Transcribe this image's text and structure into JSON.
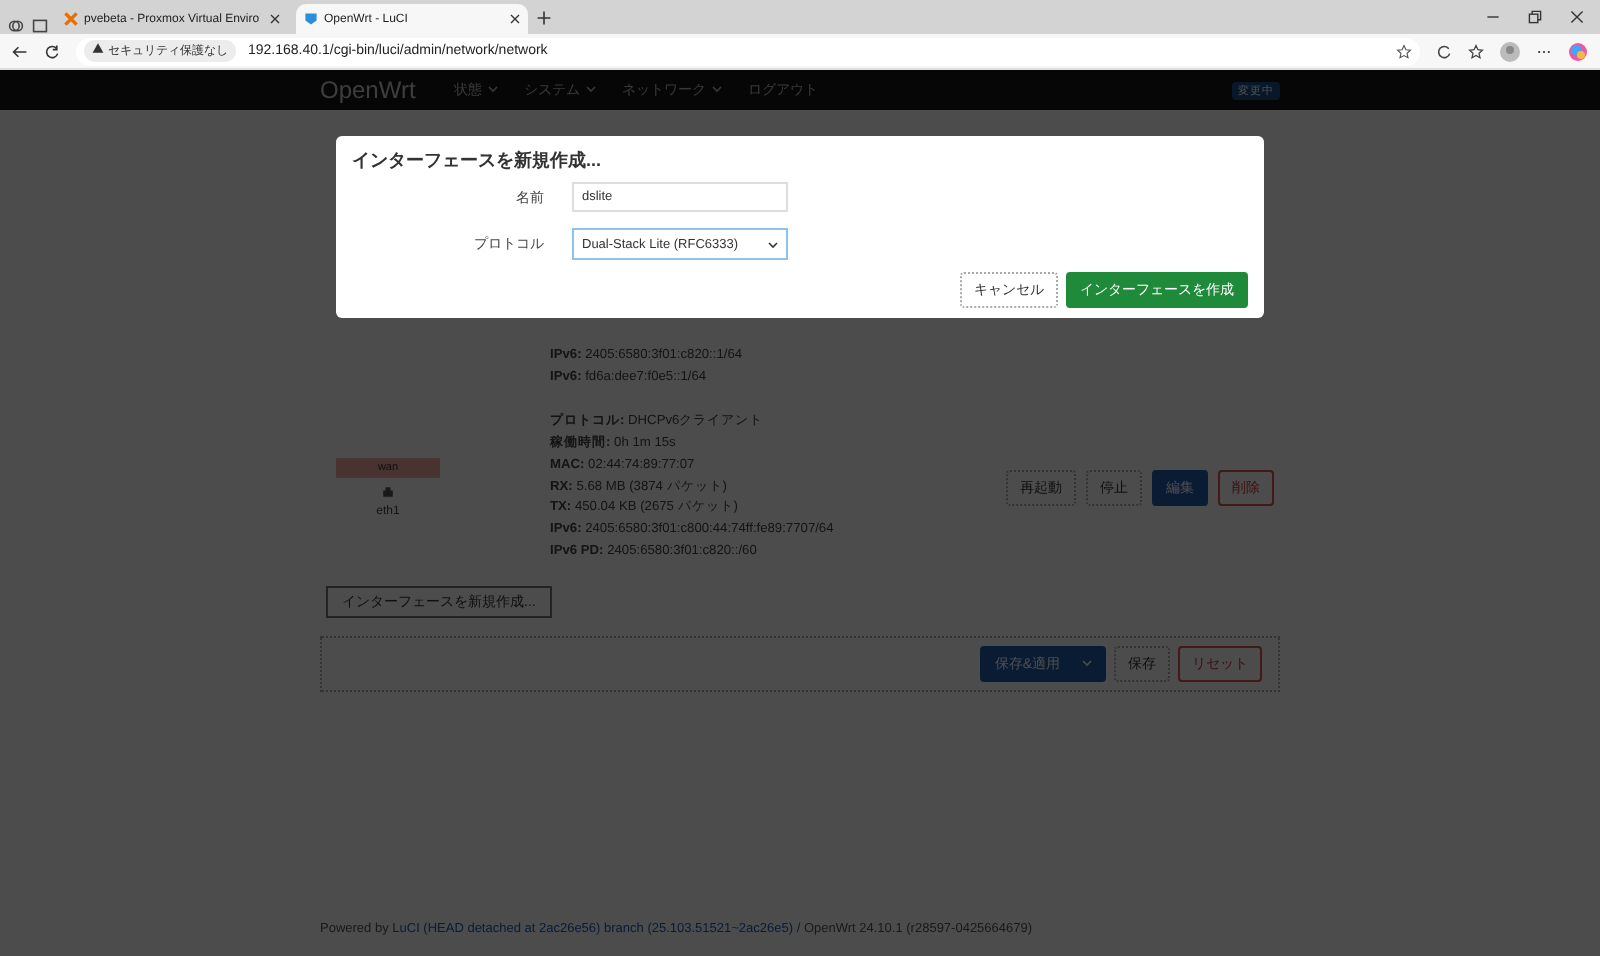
{
  "browser": {
    "tabs": [
      {
        "title": "pvebeta - Proxmox Virtual Enviro",
        "selected": false
      },
      {
        "title": "OpenWrt - LuCI",
        "selected": true
      }
    ],
    "security": "セキュリティ保護なし",
    "url": "192.168.40.1/cgi-bin/luci/admin/network/network"
  },
  "navbar": {
    "brand": "OpenWrt",
    "menus": [
      "状態",
      "システム",
      "ネットワーク"
    ],
    "logout": "ログアウト",
    "badge": "変更中"
  },
  "interfaces": [
    {
      "details": [
        "**IPv6:** 2405:6580:3f01:c820::1/64",
        "**IPv6:** fd6a:dee7:f0e5::1/64"
      ]
    },
    {
      "name": "wan",
      "device": "eth1",
      "details": [
        "**プロトコル:** DHCPv6クライアント",
        "**稼働時間:** 0h 1m 15s",
        "**MAC:** 02:44:74:89:77:07",
        "**RX:** 5.68 MB (3874 パケット)",
        "**TX:** 450.04 KB (2675 パケット)",
        "**IPv6:** 2405:6580:3f01:c800:44:74ff:fe89:7707/64",
        "**IPv6 PD:** 2405:6580:3f01:c820::/60"
      ],
      "actions": [
        {
          "label": "再起動",
          "kind": "plain"
        },
        {
          "label": "停止",
          "kind": "plain"
        },
        {
          "label": "編集",
          "kind": "primary"
        },
        {
          "label": "削除",
          "kind": "danger"
        }
      ]
    }
  ],
  "add_button": "インターフェースを新規作成...",
  "save_bar": [
    {
      "label": "保存&適用",
      "kind": "split"
    },
    {
      "label": "保存",
      "kind": "plain"
    },
    {
      "label": "リセット",
      "kind": "danger"
    }
  ],
  "footer": {
    "prefix": "Powered by",
    "link": "LuCI (HEAD detached at 2ac26e56) branch (25.103.51521~2ac26e5)",
    "suffix": "/ OpenWrt 24.10.1 (r28597-0425664679)"
  },
  "dialog": {
    "title": "インターフェースを新規作成...",
    "name_label": "名前",
    "name_value": "dslite",
    "protocol_label": "プロトコル",
    "protocol_value": "Dual-Stack Lite (RFC6333)",
    "buttons": [
      {
        "label": "キャンセル",
        "kind": "plain"
      },
      {
        "label": "インターフェースを作成",
        "kind": "positive"
      }
    ]
  }
}
